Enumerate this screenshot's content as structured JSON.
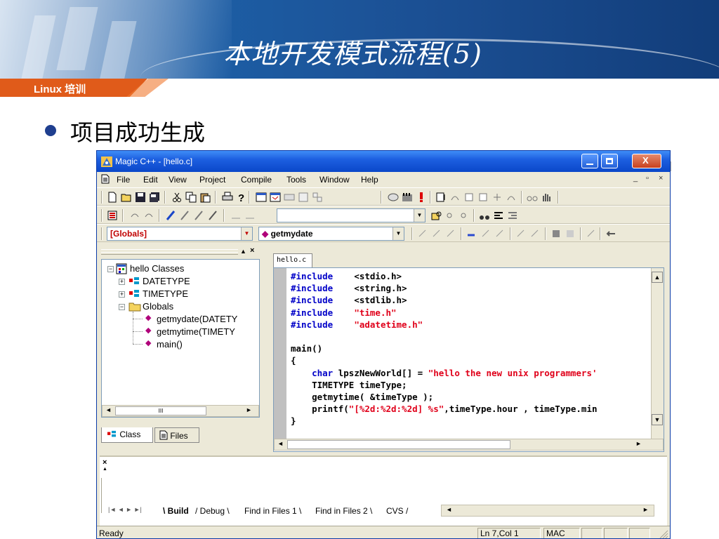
{
  "slide": {
    "course_label": "Linux 培训",
    "title": "本地开发模式流程(5)",
    "subtitle": "项目成功生成"
  },
  "window": {
    "title": "Magic C++ - [hello.c]",
    "menu": [
      "File",
      "Edit",
      "View",
      "Project",
      "Compile",
      "Tools",
      "Window",
      "Help"
    ],
    "menu_accel": [
      "F",
      "E",
      "V",
      "P",
      "C",
      "T",
      "W",
      "H"
    ],
    "mdi_controls": [
      "_",
      "▫",
      "×"
    ]
  },
  "toolbar": {
    "scope_combo": "[Globals]",
    "function_combo": "getmydate",
    "find_combo": ""
  },
  "class_view": {
    "root": "hello Classes",
    "nodes": [
      {
        "label": "DATETYPE"
      },
      {
        "label": "TIMETYPE"
      },
      {
        "label": "Globals"
      },
      {
        "label": "getmydate(DATETY"
      },
      {
        "label": "getmytime(TIMETY"
      },
      {
        "label": "main()"
      }
    ],
    "scroll_mark": "III",
    "tabs": [
      "Class",
      "Files"
    ]
  },
  "editor": {
    "tab": "hello.c",
    "lines": [
      [
        {
          "t": "#include",
          "c": "kw"
        },
        {
          "t": "    <stdio.h>",
          "c": "tx"
        }
      ],
      [
        {
          "t": "#include",
          "c": "kw"
        },
        {
          "t": "    <string.h>",
          "c": "tx"
        }
      ],
      [
        {
          "t": "#include",
          "c": "kw"
        },
        {
          "t": "    <stdlib.h>",
          "c": "tx"
        }
      ],
      [
        {
          "t": "#include",
          "c": "kw"
        },
        {
          "t": "    \"time.h\"",
          "c": "st"
        }
      ],
      [
        {
          "t": "#include",
          "c": "kw"
        },
        {
          "t": "    \"adatetime.h\"",
          "c": "st"
        }
      ],
      [
        {
          "t": "",
          "c": "tx"
        }
      ],
      [
        {
          "t": "main()",
          "c": "tx"
        }
      ],
      [
        {
          "t": "{",
          "c": "tx"
        }
      ],
      [
        {
          "t": "    ",
          "c": "tx"
        },
        {
          "t": "char",
          "c": "kw"
        },
        {
          "t": " lpszNewWorld[] = ",
          "c": "tx"
        },
        {
          "t": "\"hello the new unix programmers' ",
          "c": "st"
        }
      ],
      [
        {
          "t": "    TIMETYPE timeType;",
          "c": "tx"
        }
      ],
      [
        {
          "t": "    getmytime( &timeType );",
          "c": "tx"
        }
      ],
      [
        {
          "t": "    printf(",
          "c": "tx"
        },
        {
          "t": "\"[%2d:%2d:%2d] %s\"",
          "c": "st"
        },
        {
          "t": ",timeType.hour , timeType.min",
          "c": "tx"
        }
      ],
      [
        {
          "t": "}",
          "c": "tx"
        }
      ]
    ]
  },
  "output": {
    "tabs": [
      "Build",
      "Debug",
      "Find in Files 1",
      "Find in Files 2",
      "CVS"
    ],
    "active_tab": "Build"
  },
  "status": {
    "text": "Ready",
    "position": "Ln 7,Col 1",
    "line_ending": "MAC"
  },
  "colors": {
    "keyword": "#0000c8",
    "string": "#e0001a",
    "accent_orange": "#e05b1a",
    "header_blue": "#1b4f93"
  }
}
